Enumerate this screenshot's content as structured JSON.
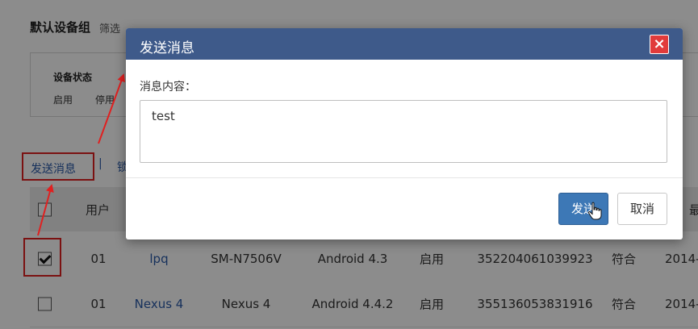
{
  "page": {
    "group_title": "默认设备组",
    "group_filter": "筛选"
  },
  "filter": {
    "title": "设备状态",
    "options": [
      "启用",
      "停用"
    ]
  },
  "actions": {
    "send_message": "发送消息",
    "separator": "|",
    "next_partial": "锁"
  },
  "table": {
    "header_user": "用户",
    "header_more": "最",
    "rows": [
      {
        "checked": true,
        "user": "01",
        "name": "lpq",
        "model": "SM-N7506V",
        "os": "Android 4.3",
        "status": "启用",
        "imei": "352204061039923",
        "compliance": "符合",
        "date": "2014-"
      },
      {
        "checked": false,
        "user": "01",
        "name": "Nexus 4",
        "model": "Nexus 4",
        "os": "Android 4.4.2",
        "status": "启用",
        "imei": "355136053831916",
        "compliance": "符合",
        "date": "2014-"
      }
    ]
  },
  "modal": {
    "title": "发送消息",
    "close_glyph": "×",
    "field_label": "消息内容：",
    "message_value": "test",
    "send_label": "发送",
    "cancel_label": "取消"
  },
  "colors": {
    "header_bg": "#3e5a8a",
    "primary_button": "#3d78b6",
    "close_button": "#e13b3b",
    "annotation_red": "#e02020",
    "link_blue": "#2a5aa8"
  }
}
